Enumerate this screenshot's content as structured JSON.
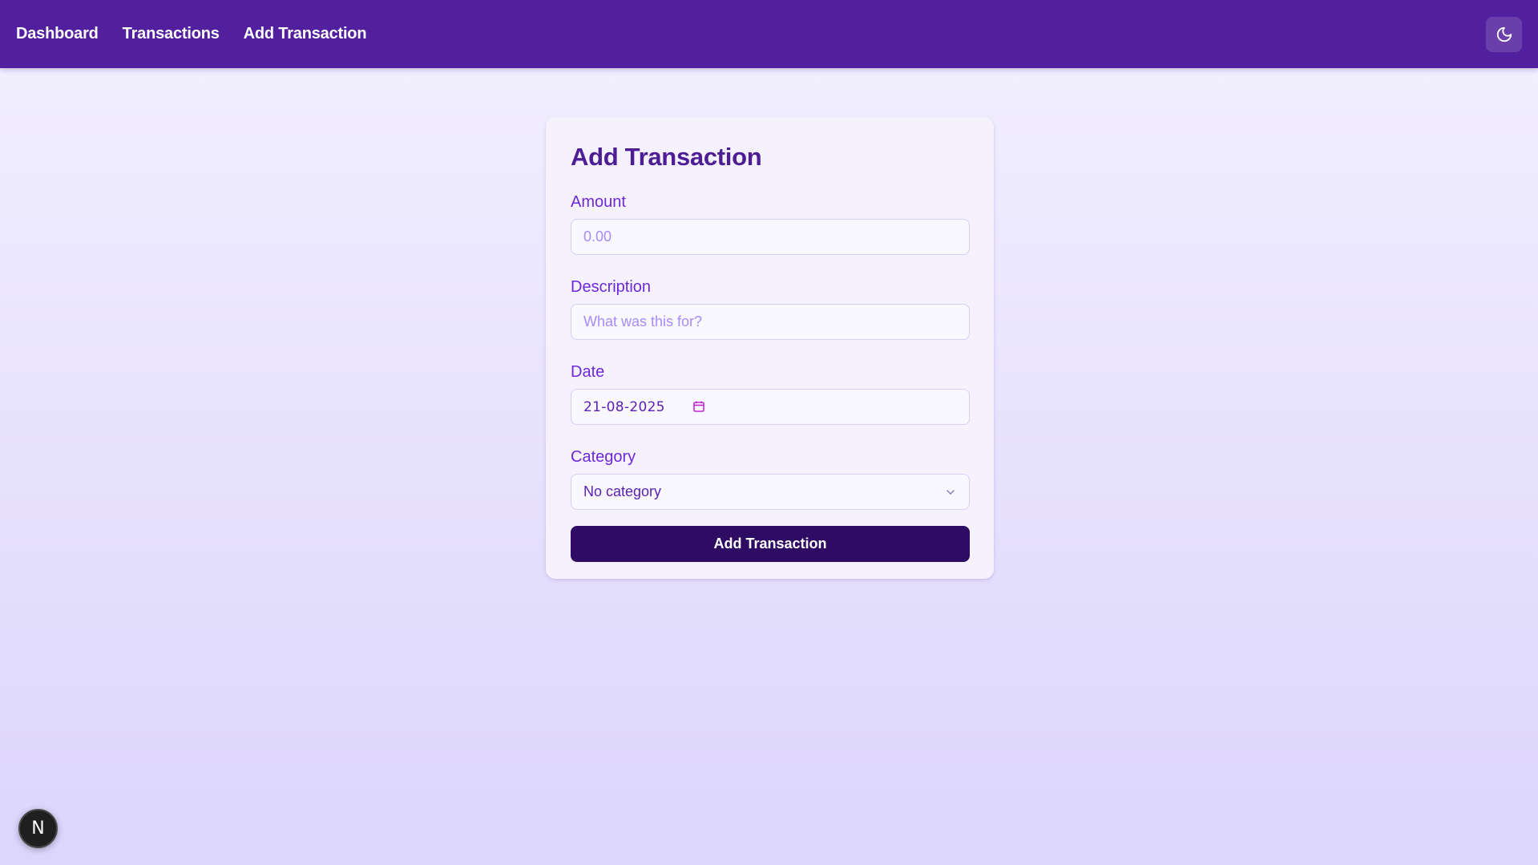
{
  "nav": {
    "links": [
      {
        "label": "Dashboard"
      },
      {
        "label": "Transactions"
      },
      {
        "label": "Add Transaction"
      }
    ],
    "theme_toggle_icon": "moon-icon"
  },
  "form": {
    "title": "Add Transaction",
    "amount": {
      "label": "Amount",
      "placeholder": "0.00",
      "value": ""
    },
    "description": {
      "label": "Description",
      "placeholder": "What was this for?",
      "value": ""
    },
    "date": {
      "label": "Date",
      "value": "21-08-2025",
      "icon": "calendar-icon"
    },
    "category": {
      "label": "Category",
      "selected": "No category",
      "icon": "chevron-down-icon"
    },
    "submit_label": "Add Transaction"
  },
  "dev_badge": {
    "letter": "N"
  },
  "colors": {
    "header_bg": "#52209f",
    "title": "#4c1d95",
    "label": "#6d28d9",
    "button_bg": "#2f0c64",
    "page_bg_top": "#f3f0fe",
    "page_bg_bottom": "#dcd5fc"
  }
}
